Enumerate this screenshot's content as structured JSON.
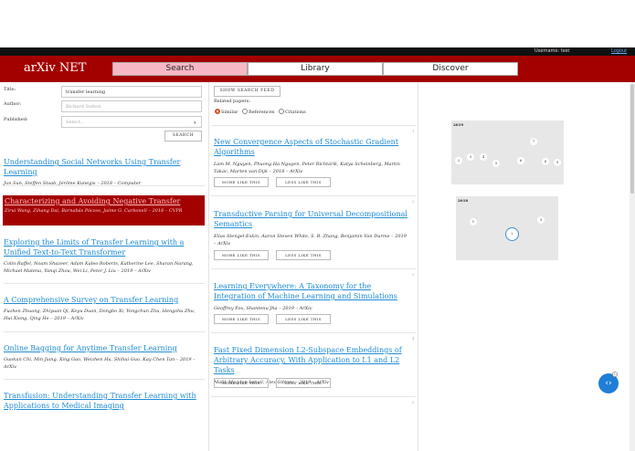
{
  "topbar": {
    "username": "Username: test",
    "logout": "Logout"
  },
  "nav": {
    "brand": "arXiv NET",
    "tabs": [
      "Search",
      "Library",
      "Discover"
    ],
    "active_tab": "Search"
  },
  "search_form": {
    "title_label": "Title:",
    "title_value": "transfer learning",
    "author_label": "Author:",
    "author_placeholder": "Richard Sutton",
    "published_label": "Published:",
    "published_placeholder": "Select...",
    "search_button": "SEARCH"
  },
  "results": [
    {
      "title": "Understanding Social Networks Using Transfer Learning",
      "meta": "Jun Sun, Steffen Staab, Jérôme Kunegis – 2018 – Computer"
    },
    {
      "title": "Characterizing and Avoiding Negative Transfer",
      "meta": "Zirui Wang, Zihang Dai, Barnabás Póczos, Jaime G. Carbonell – 2018 – CVPR",
      "highlighted": true
    },
    {
      "title": "Exploring the Limits of Transfer Learning with a Unified Text-to-Text Transformer",
      "meta": "Colin Raffel, Noam Shazeer, Adam Kaleo Roberts, Katherine Lee, Sharan Narang, Michael Matena, Yanqi Zhou, Wei Li, Peter J. Liu – 2019 – ArXiv"
    },
    {
      "title": "A Comprehensive Survey on Transfer Learning",
      "meta": "Fuzhen Zhuang, Zhiyuan Qi, Keyu Duan, Dongbo Xi, Yongchun Zhu, Hengshu Zhu, Hui Xiong, Qing He – 2019 – ArXiv"
    },
    {
      "title": "Online Bagging for Anytime Transfer Learning",
      "meta": "Guokun Chi, Min Jiang, Xing Gao, Weizhen Hu, Shihui Guo, Kay Chen Tan – 2019 – ArXiv"
    },
    {
      "title": "Transfusion: Understanding Transfer Learning with Applications to Medical Imaging",
      "meta": ""
    }
  ],
  "feed": {
    "show_button": "SHOW SEARCH FEED",
    "related_label": "Related papers:",
    "radios": [
      "Similar",
      "References",
      "Citations"
    ],
    "selected_radio": "Similar",
    "more_label": "MORE LIKE THIS",
    "less_label": "LESS LIKE THIS",
    "papers": [
      {
        "num": "1",
        "title": "New Convergence Aspects of Stochastic Gradient Algorithms",
        "meta": "Lam M. Nguyen, Phuong Ha Nguyen, Peter Richtárik, Katya Scheinberg, Martin Takác, Marten van Dijk – 2018 – ArXiv"
      },
      {
        "num": "2",
        "title": "Transductive Parsing for Universal Decompositional Semantics",
        "meta": "Elias Stengel-Eskin, Aaron Steven White, S. B. Zhang, Benjamin Van Durme – 2019 – ArXiv"
      },
      {
        "num": "3",
        "title": "Learning Everywhere: A Taxonomy for the Integration of Machine Learning and Simulations",
        "meta": "Geoffrey Fox, Shantenu Jha – 2019 – ArXiv"
      },
      {
        "num": "4",
        "title": "Fast Fixed Dimension L2-Subspace Embeddings of Arbitrary Accuracy, With Application to L1 and L2 Tasks",
        "meta": "Malik Magdon-Ismail, Alex Gittens – 2019 – ArXiv"
      },
      {
        "num": "5",
        "title": "",
        "meta": ""
      }
    ]
  },
  "graphs": [
    {
      "year": "2019",
      "nodes": [
        "2",
        "3",
        "4",
        "5",
        "6",
        "7",
        "8",
        "9",
        "10"
      ]
    },
    {
      "year": "2018",
      "nodes": [
        "1",
        "2",
        "3"
      ]
    }
  ],
  "fab": {
    "icon": "code-arrows-icon",
    "badge": "1"
  }
}
